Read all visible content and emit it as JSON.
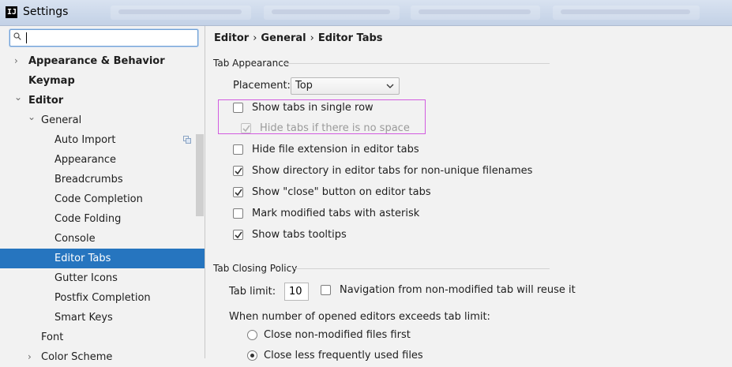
{
  "window": {
    "title": "Settings",
    "logo_text": "IJ"
  },
  "search": {
    "placeholder": "",
    "value": ""
  },
  "tree": [
    {
      "label": "Appearance & Behavior",
      "arrow": "›",
      "bold": true
    },
    {
      "label": "Keymap",
      "arrow": "",
      "bold": true
    },
    {
      "label": "Editor",
      "arrow": "⌄",
      "bold": true
    },
    {
      "label": "General",
      "arrow": "⌄",
      "bold": false
    },
    {
      "label": "Auto Import",
      "arrow": "",
      "bold": false
    },
    {
      "label": "Appearance",
      "arrow": "",
      "bold": false
    },
    {
      "label": "Breadcrumbs",
      "arrow": "",
      "bold": false
    },
    {
      "label": "Code Completion",
      "arrow": "",
      "bold": false
    },
    {
      "label": "Code Folding",
      "arrow": "",
      "bold": false
    },
    {
      "label": "Console",
      "arrow": "",
      "bold": false
    },
    {
      "label": "Editor Tabs",
      "arrow": "",
      "bold": false,
      "selected": true
    },
    {
      "label": "Gutter Icons",
      "arrow": "",
      "bold": false
    },
    {
      "label": "Postfix Completion",
      "arrow": "",
      "bold": false
    },
    {
      "label": "Smart Keys",
      "arrow": "",
      "bold": false
    },
    {
      "label": "Font",
      "arrow": "",
      "bold": false
    },
    {
      "label": "Color Scheme",
      "arrow": "›",
      "bold": false
    }
  ],
  "breadcrumb": [
    "Editor",
    "General",
    "Editor Tabs"
  ],
  "breadcrumb_sep": "›",
  "tab_appearance": {
    "title": "Tab Appearance",
    "placement_label": "Placement:",
    "placement_value": "Top",
    "options": [
      {
        "label": "Show tabs in single row",
        "checked": false,
        "disabled": false
      },
      {
        "label": "Hide tabs if there is no space",
        "checked": true,
        "disabled": true
      },
      {
        "label": "Hide file extension in editor tabs",
        "checked": false,
        "disabled": false
      },
      {
        "label": "Show directory in editor tabs for non-unique filenames",
        "checked": true,
        "disabled": false
      },
      {
        "label": "Show \"close\" button on editor tabs",
        "checked": true,
        "disabled": false
      },
      {
        "label": "Mark modified tabs with asterisk",
        "checked": false,
        "disabled": false
      },
      {
        "label": "Show tabs tooltips",
        "checked": true,
        "disabled": false
      }
    ]
  },
  "tab_closing": {
    "title": "Tab Closing Policy",
    "tab_limit_label": "Tab limit:",
    "tab_limit_value": "10",
    "reuse_label": "Navigation from non-modified tab will reuse it",
    "reuse_checked": false,
    "exceeds_label": "When number of opened editors exceeds tab limit:",
    "radio_options": [
      {
        "label": "Close non-modified files first",
        "selected": false
      },
      {
        "label": "Close less frequently used files",
        "selected": true
      }
    ]
  },
  "colors": {
    "selection": "#2675bf",
    "highlight_box": "#d25ce0",
    "titlebar": "#c9d6e8"
  },
  "icons": {
    "search": "search-icon",
    "copy": "copy-icon",
    "dropdown": "chevron-down-icon",
    "checkmark": "check-icon"
  }
}
